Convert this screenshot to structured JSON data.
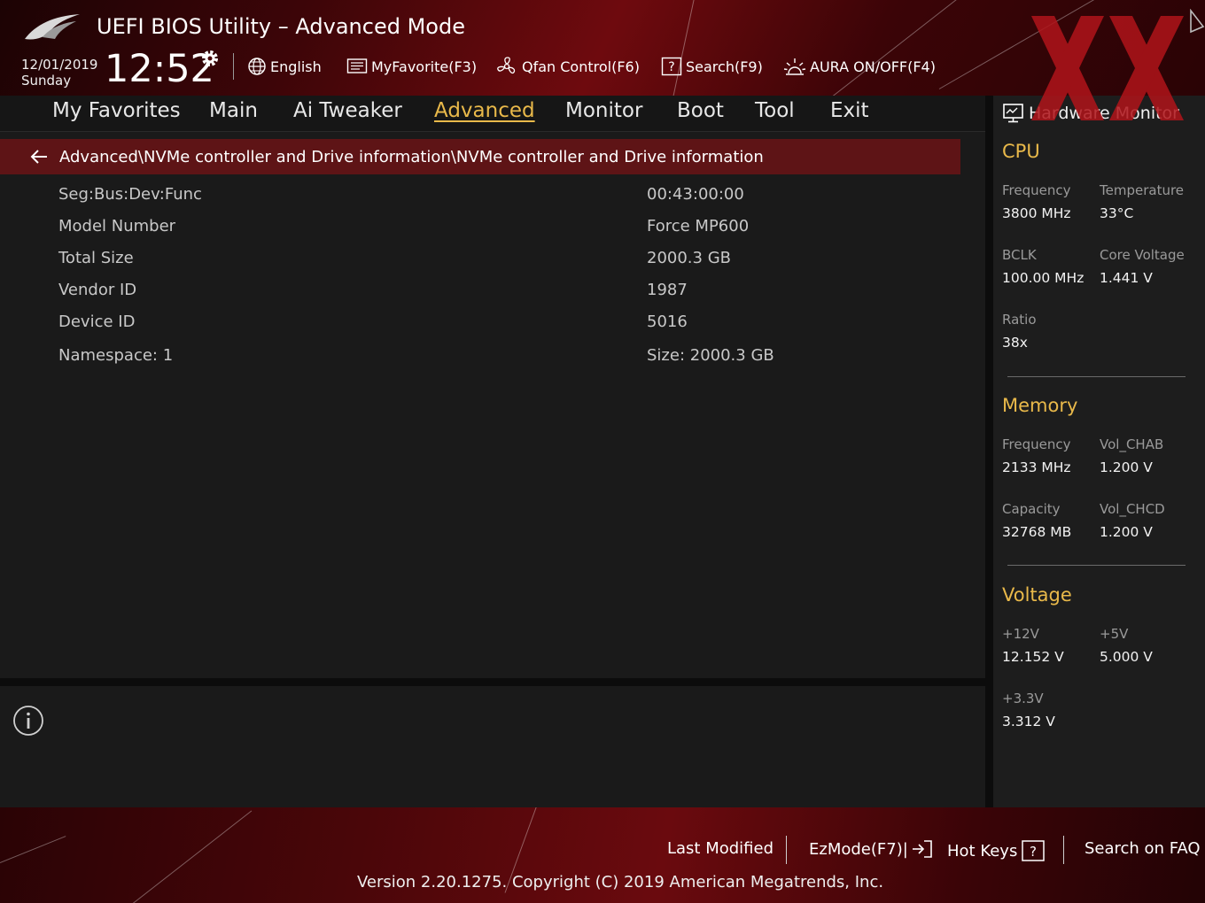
{
  "header": {
    "title": "UEFI BIOS Utility – Advanced Mode",
    "date": "12/01/2019",
    "day": "Sunday",
    "time": "12:52",
    "tools": {
      "language": "English",
      "my_favorite": "MyFavorite(F3)",
      "qfan": "Qfan Control(F6)",
      "search": "Search(F9)",
      "aura": "AURA ON/OFF(F4)"
    }
  },
  "nav": {
    "tabs": [
      "My Favorites",
      "Main",
      "Ai Tweaker",
      "Advanced",
      "Monitor",
      "Boot",
      "Tool",
      "Exit"
    ],
    "active": "Advanced"
  },
  "breadcrumb": "Advanced\\NVMe controller and Drive information\\NVMe controller and Drive information",
  "rows": [
    {
      "label": "Seg:Bus:Dev:Func",
      "value": "00:43:00:00"
    },
    {
      "label": "Model Number",
      "value": "Force MP600"
    },
    {
      "label": "Total Size",
      "value": "2000.3 GB"
    },
    {
      "label": "Vendor ID",
      "value": "1987"
    },
    {
      "label": "Device ID",
      "value": "5016"
    },
    {
      "label": "Namespace: 1",
      "value": "Size: 2000.3 GB"
    }
  ],
  "hw_monitor": {
    "title": "Hardware Monitor",
    "cpu": {
      "title": "CPU",
      "frequency_label": "Frequency",
      "frequency": "3800 MHz",
      "temperature_label": "Temperature",
      "temperature": "33°C",
      "bclk_label": "BCLK",
      "bclk": "100.00 MHz",
      "core_voltage_label": "Core Voltage",
      "core_voltage": "1.441 V",
      "ratio_label": "Ratio",
      "ratio": "38x"
    },
    "memory": {
      "title": "Memory",
      "frequency_label": "Frequency",
      "frequency": "2133 MHz",
      "vol_chab_label": "Vol_CHAB",
      "vol_chab": "1.200 V",
      "capacity_label": "Capacity",
      "capacity": "32768 MB",
      "vol_chcd_label": "Vol_CHCD",
      "vol_chcd": "1.200 V"
    },
    "voltage": {
      "title": "Voltage",
      "v12_label": "+12V",
      "v12": "12.152 V",
      "v5_label": "+5V",
      "v5": "5.000 V",
      "v33_label": "+3.3V",
      "v33": "3.312 V"
    }
  },
  "footer": {
    "last_modified": "Last Modified",
    "ezmode": "EzMode(F7)|",
    "hot_keys": "Hot Keys",
    "search_faq": "Search on FAQ",
    "version": "Version 2.20.1275. Copyright (C) 2019 American Megatrends, Inc."
  },
  "colors": {
    "accent": "#e9b94a",
    "crumb_bg": "#5e1416",
    "brand_red": "#8a0c12"
  }
}
